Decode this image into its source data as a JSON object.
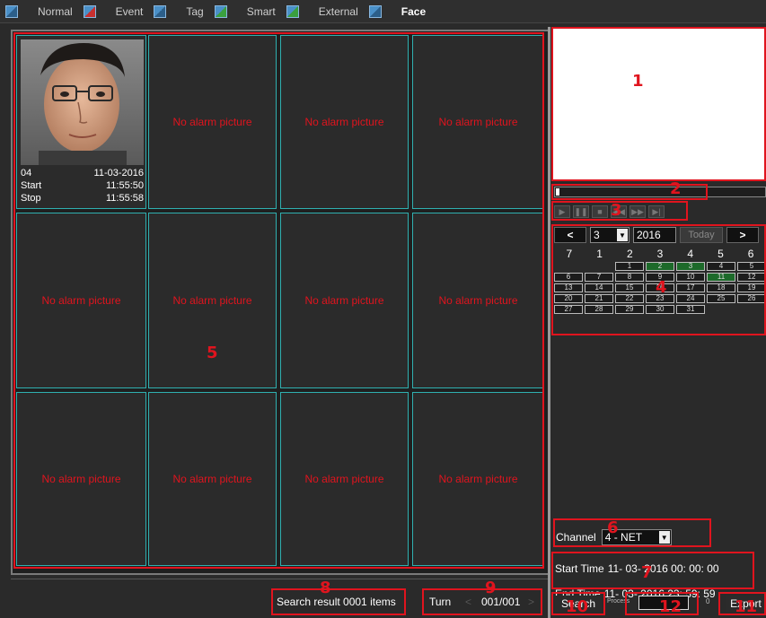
{
  "tabs": [
    {
      "label": "Normal",
      "icon": "normal-icon"
    },
    {
      "label": "Event",
      "icon": "event-icon"
    },
    {
      "label": "Tag",
      "icon": "tag-icon"
    },
    {
      "label": "Smart",
      "icon": "smart-icon"
    },
    {
      "label": "External",
      "icon": "external-icon"
    },
    {
      "label": "Face",
      "icon": "face-icon",
      "active": true
    }
  ],
  "grid": {
    "face_card": {
      "channel": "04",
      "date": "11-03-2016",
      "start_label": "Start",
      "start_time": "11:55:50",
      "stop_label": "Stop",
      "stop_time": "11:55:58"
    },
    "empty_text": "No alarm picture"
  },
  "status": {
    "search_result": "Search result  0001 items",
    "turn_label": "Turn",
    "page": "001/001"
  },
  "calendar": {
    "prev": "<",
    "next": ">",
    "month": "3",
    "year": "2016",
    "today": "Today",
    "weekdays": [
      "7",
      "1",
      "2",
      "3",
      "4",
      "5",
      "6"
    ],
    "days": [
      "",
      "",
      "1",
      "2",
      "3",
      "4",
      "5",
      "6",
      "7",
      "8",
      "9",
      "10",
      "11",
      "12",
      "13",
      "14",
      "15",
      "16",
      "17",
      "18",
      "19",
      "20",
      "21",
      "22",
      "23",
      "24",
      "25",
      "26",
      "27",
      "28",
      "29",
      "30",
      "31"
    ],
    "recorded_days": [
      "2",
      "3",
      "11"
    ]
  },
  "channel": {
    "label": "Channel",
    "value": "4 - NET"
  },
  "time": {
    "start_label": "Start Time",
    "start_value": "11- 03- 2016    00: 00: 00",
    "end_label": "End Time",
    "end_value": "11- 03- 2016    23: 59: 59"
  },
  "buttons": {
    "search": "Search",
    "process_label": "Process",
    "process_value": "0",
    "export": "Export"
  },
  "markers": [
    "1",
    "2",
    "3",
    "4",
    "5",
    "6",
    "7",
    "8",
    "9",
    "10",
    "11",
    "12"
  ],
  "colors": {
    "annotation": "#e0141e",
    "cell_border": "#2fb0b0",
    "recorded_day": "#1d6a2a"
  }
}
